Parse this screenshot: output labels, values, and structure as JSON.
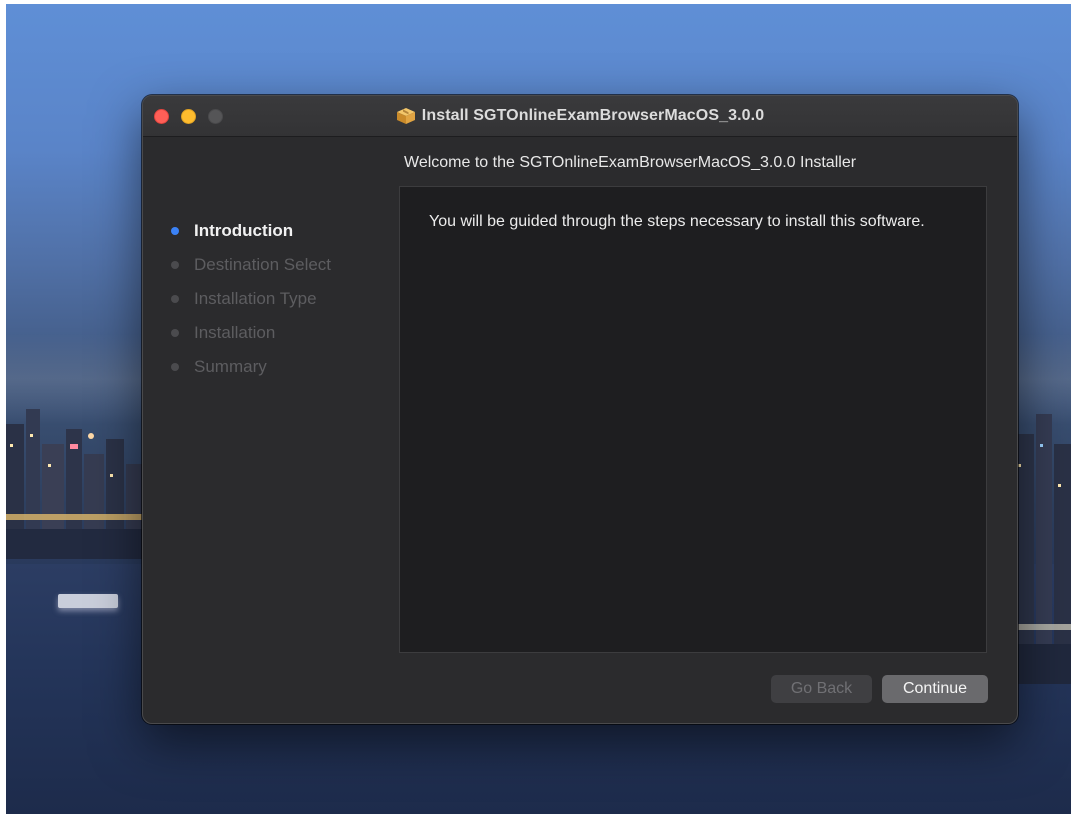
{
  "window": {
    "title": "Install SGTOnlineExamBrowserMacOS_3.0.0",
    "title_icon": "package-icon"
  },
  "sidebar": {
    "steps": [
      {
        "label": "Introduction",
        "active": true
      },
      {
        "label": "Destination Select",
        "active": false
      },
      {
        "label": "Installation Type",
        "active": false
      },
      {
        "label": "Installation",
        "active": false
      },
      {
        "label": "Summary",
        "active": false
      }
    ]
  },
  "main": {
    "heading": "Welcome to the SGTOnlineExamBrowserMacOS_3.0.0 Installer",
    "body": "You will be guided through the steps necessary to install this software."
  },
  "buttons": {
    "back_label": "Go Back",
    "back_enabled": false,
    "continue_label": "Continue"
  },
  "colors": {
    "accent": "#3b82f6",
    "close": "#fe5f57",
    "minimize": "#febc2e",
    "window_bg": "#2b2b2d"
  }
}
